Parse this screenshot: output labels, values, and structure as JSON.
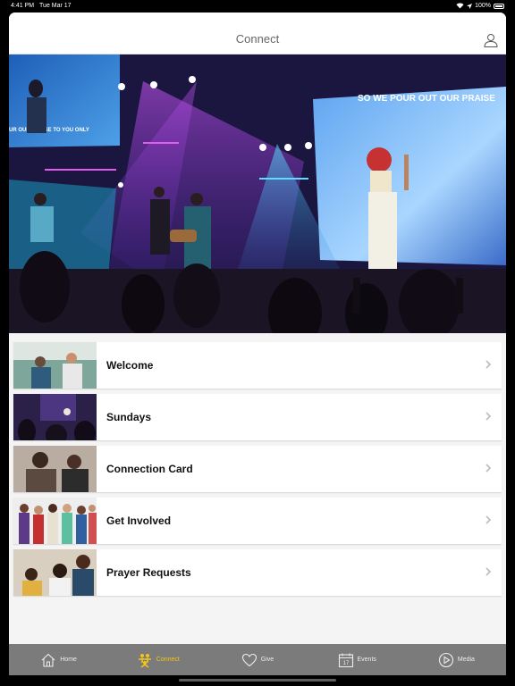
{
  "status_bar": {
    "time": "4:41 PM",
    "date": "Tue Mar 17",
    "battery": "100%"
  },
  "header": {
    "title": "Connect",
    "profile_icon": "person-icon"
  },
  "hero": {
    "screen_text_left": "UR OUR PRAISE TO YOU ONLY",
    "screen_text_right": "SO WE POUR OUT OUR PRAISE"
  },
  "menu": {
    "items": [
      {
        "label": "Welcome"
      },
      {
        "label": "Sundays"
      },
      {
        "label": "Connection Card"
      },
      {
        "label": "Get Involved"
      },
      {
        "label": "Prayer Requests"
      }
    ]
  },
  "tabs": [
    {
      "label": "Home",
      "icon": "home-icon"
    },
    {
      "label": "Connect",
      "icon": "people-icon"
    },
    {
      "label": "Give",
      "icon": "heart-icon"
    },
    {
      "label": "Events",
      "icon": "calendar-icon"
    },
    {
      "label": "Media",
      "icon": "play-icon"
    }
  ],
  "colors": {
    "accent": "#f3c41a",
    "tab_bar": "#7b7b7b",
    "background": "#f4f4f4"
  }
}
